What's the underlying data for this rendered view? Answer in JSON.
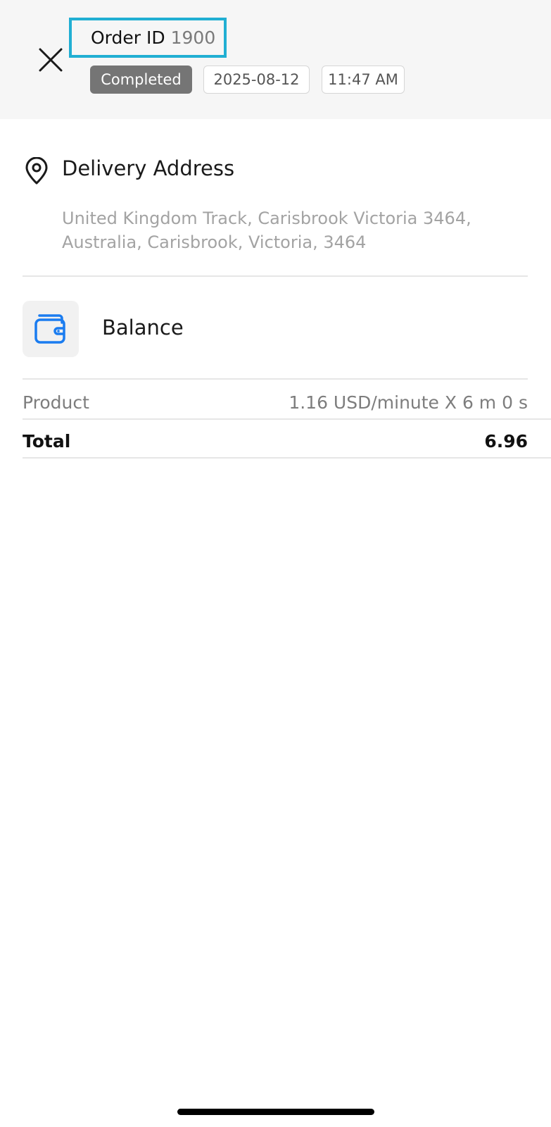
{
  "order": {
    "id_label": "Order ID",
    "id_value": "1900",
    "status": "Completed",
    "date": "2025-08-12",
    "time": "11:47 AM"
  },
  "delivery": {
    "title": "Delivery Address",
    "address": "United Kingdom Track, Carisbrook Victoria 3464, Australia, Carisbrook, Victoria, 3464",
    "icon": "location-pin-icon"
  },
  "payment": {
    "method": "Balance",
    "icon": "wallet-icon",
    "accent_color": "#1a7cf0"
  },
  "summary": {
    "product_label": "Product",
    "product_value": "1.16 USD/minute X 6 m 0 s",
    "total_label": "Total",
    "total_value": "6.96"
  },
  "colors": {
    "header_bg": "#f6f6f6",
    "highlight_border": "#21afd3",
    "status_chip_bg": "#757575"
  }
}
